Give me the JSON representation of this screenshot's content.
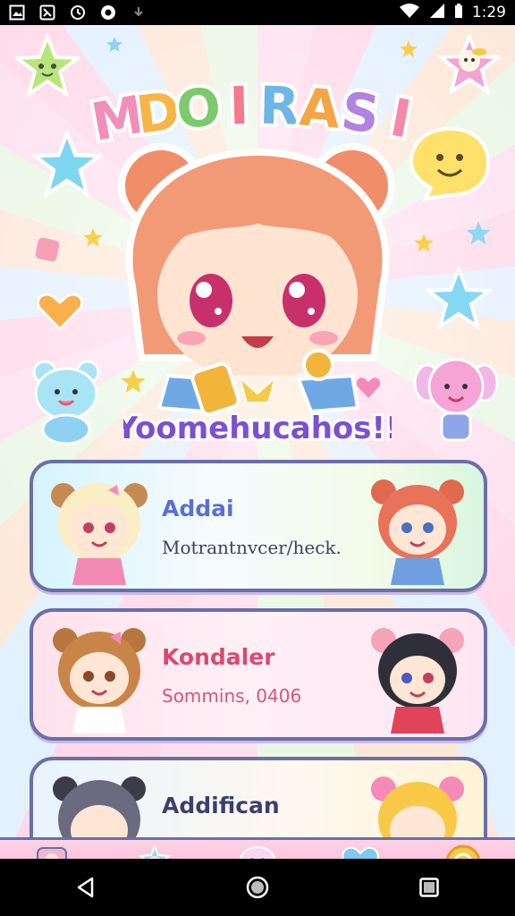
{
  "status_bar": {
    "time": "1:29",
    "left_icons": [
      "photo-icon",
      "image-icon",
      "sync-icon",
      "chat-icon",
      "download-icon"
    ],
    "right_icons": [
      "wifi-icon",
      "signal-icon",
      "battery-icon"
    ]
  },
  "header": {
    "logo_text": "MDOIRASI",
    "logo_colors": [
      "#f28fb8",
      "#f7b548",
      "#7cc96e",
      "#f47a8c",
      "#6fb6e8",
      "#f5a545",
      "#b083e0",
      "#f58aa8"
    ]
  },
  "hero": {
    "subtitle": "Yoomehucahos!!"
  },
  "cards": [
    {
      "title": "Addai",
      "subtitle": "Motrantnvcer/heck."
    },
    {
      "title": "Kondaler",
      "subtitle": "Sommins, 0406"
    },
    {
      "title": "Addifican",
      "subtitle": ""
    }
  ],
  "bottom_nav": {
    "items": [
      "home-tab",
      "friends-tab",
      "chat-tab",
      "favorites-tab",
      "settings-tab"
    ]
  },
  "system_nav": {
    "buttons": [
      "back-button",
      "home-button",
      "recents-button"
    ]
  }
}
